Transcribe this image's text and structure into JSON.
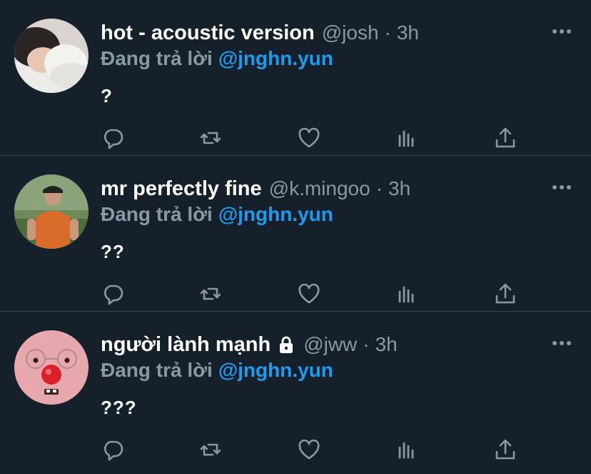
{
  "colors": {
    "background": "#15202b",
    "divider": "#38444d",
    "muted": "#8899a6",
    "link": "#1d9bf0",
    "text": "#ffffff"
  },
  "tweets": [
    {
      "display_name": "hot - acoustic version",
      "handle": "@josh",
      "separator": "·",
      "time": "3h",
      "locked": false,
      "reply_prefix": "Đang trả lời",
      "reply_to": "@jnghn.yun",
      "text": "?",
      "avatar": "person-lying-on-pillow"
    },
    {
      "display_name": "mr perfectly fine",
      "handle": "@k.mingoo",
      "separator": "·",
      "time": "3h",
      "locked": false,
      "reply_prefix": "Đang trả lời",
      "reply_to": "@jnghn.yun",
      "text": "??",
      "avatar": "person-in-orange-shirt-outdoors"
    },
    {
      "display_name": "người lành mạnh",
      "handle": "@jww",
      "separator": "·",
      "time": "3h",
      "locked": true,
      "reply_prefix": "Đang trả lời",
      "reply_to": "@jnghn.yun",
      "text": "???",
      "avatar": "pink-plush-face-with-red-nose"
    }
  ],
  "actions": [
    "reply-icon",
    "retweet-icon",
    "like-icon",
    "analytics-icon",
    "share-icon"
  ]
}
